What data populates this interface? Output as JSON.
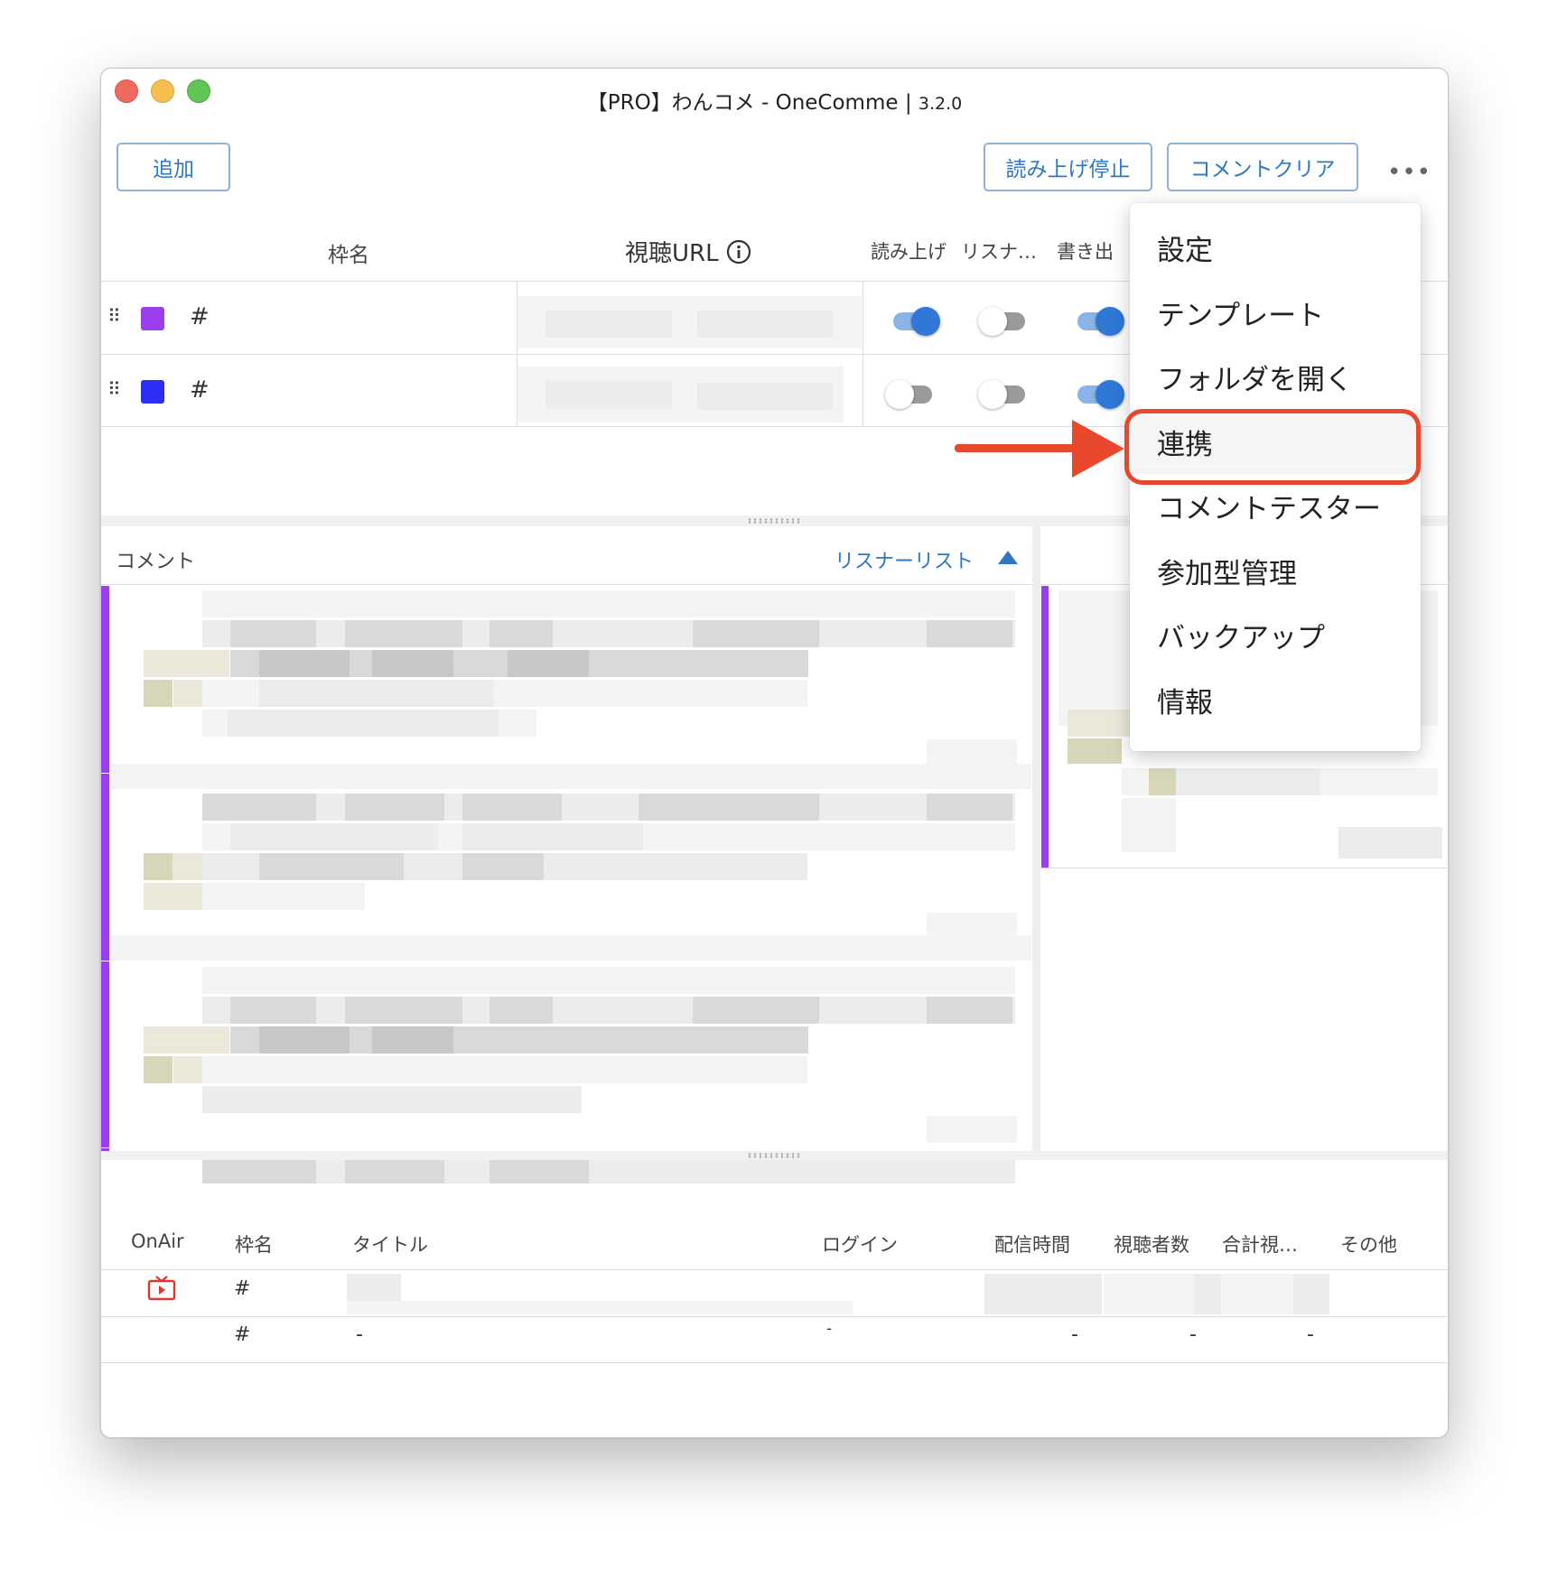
{
  "window": {
    "title": "【PRO】わんコメ - OneComme",
    "version_sep": " | ",
    "version": "3.2.0"
  },
  "toolbar": {
    "add_label": "追加",
    "stop_reading_label": "読み上げ停止",
    "clear_comments_label": "コメントクリア",
    "more_label": "•••"
  },
  "frames_table": {
    "headers": {
      "name": "枠名",
      "url": "視聴URL",
      "read": "読み上げ",
      "listener": "リスナ…",
      "export": "書き出"
    },
    "rows": [
      {
        "color": "#9b3fee",
        "name": "#",
        "read_on": true,
        "listener_on": false,
        "export_on": true
      },
      {
        "color": "#2b2ef5",
        "name": "#",
        "read_on": false,
        "listener_on": false,
        "export_on": true
      }
    ]
  },
  "comments_panel": {
    "title": "コメント",
    "listener_list_label": "リスナーリスト"
  },
  "menu": {
    "items": [
      "設定",
      "テンプレート",
      "フォルダを開く",
      "連携",
      "コメントテスター",
      "参加型管理",
      "バックアップ",
      "情報"
    ],
    "highlighted": "連携"
  },
  "broadcast_table": {
    "headers": [
      "OnAir",
      "枠名",
      "タイトル",
      "ログイン",
      "配信時間",
      "視聴者数",
      "合計視…",
      "その他"
    ],
    "rows": [
      {
        "onair_icon": "tv-icon",
        "name": "#"
      },
      {
        "name": "#",
        "title": "-",
        "login": "-",
        "time": "-",
        "viewers": "-",
        "total": "-"
      }
    ]
  },
  "colors": {
    "accent_blue": "#2f78c4",
    "toggle_on": "#2f78d6",
    "frame_purple": "#9b3fee",
    "frame_blue": "#2b2ef5",
    "annotation_red": "#e8492c"
  }
}
